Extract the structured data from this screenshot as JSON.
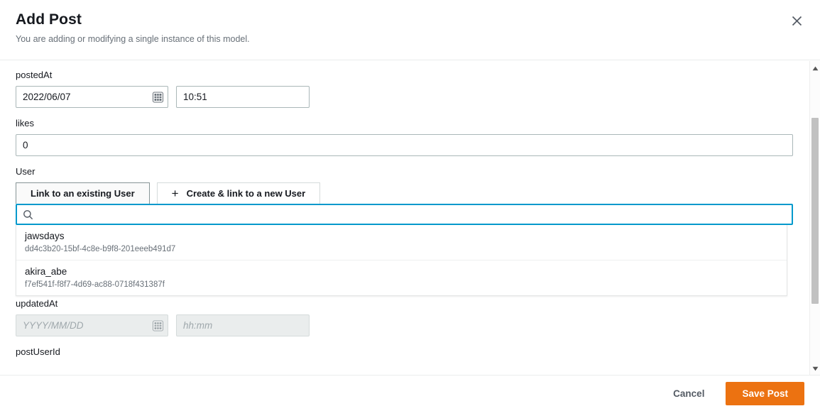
{
  "header": {
    "title": "Add Post",
    "subtitle": "You are adding or modifying a single instance of this model.",
    "close_icon": "close-icon"
  },
  "form": {
    "posted_at": {
      "label": "postedAt",
      "date_value": "2022/06/07",
      "date_placeholder": "YYYY/MM/DD",
      "time_value": "10:51",
      "time_placeholder": "hh:mm",
      "calendar_icon": "calendar-icon"
    },
    "likes": {
      "label": "likes",
      "value": "0"
    },
    "user": {
      "label": "User",
      "tabs": [
        {
          "label": "Link to an existing User",
          "active": true
        },
        {
          "label": "Create & link to a new User",
          "active": false,
          "icon": "plus-icon"
        }
      ],
      "search": {
        "value": "",
        "placeholder": "",
        "icon": "search-icon"
      },
      "results": [
        {
          "name": "jawsdays",
          "id": "dd4c3b20-15bf-4c8e-b9f8-201eeeb491d7"
        },
        {
          "name": "akira_abe",
          "id": "f7ef541f-f8f7-4d69-ac88-0718f431387f"
        }
      ]
    },
    "updated_at": {
      "label": "updatedAt",
      "date_value": "",
      "date_placeholder": "YYYY/MM/DD",
      "time_value": "",
      "time_placeholder": "hh:mm",
      "calendar_icon": "calendar-icon"
    },
    "post_user_id": {
      "label": "postUserId"
    }
  },
  "scrollbar": {
    "up_icon": "scroll-up-arrow-icon",
    "down_icon": "scroll-down-arrow-icon"
  },
  "footer": {
    "cancel_label": "Cancel",
    "save_label": "Save Post"
  },
  "colors": {
    "accent_orange": "#ec7211",
    "focus_blue": "#0099cc",
    "text": "#16191f",
    "muted_text": "#687078",
    "border": "#aab7b8",
    "disabled_bg": "#eaeded"
  }
}
